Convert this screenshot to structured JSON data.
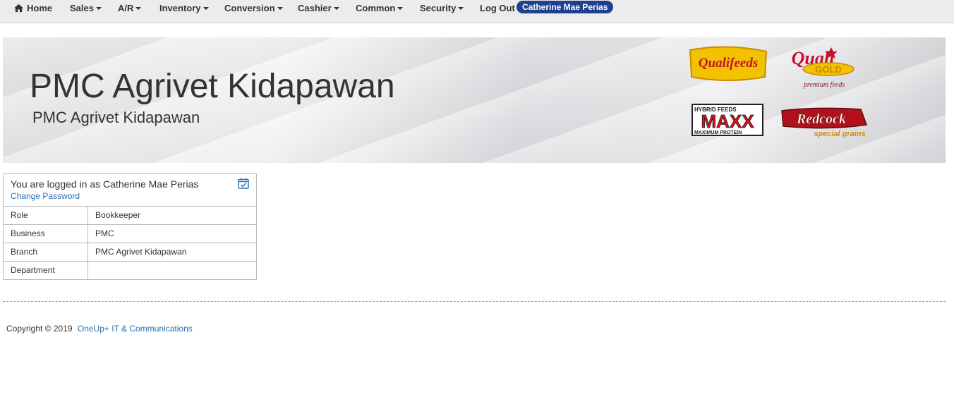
{
  "nav": {
    "home": "Home",
    "sales": "Sales",
    "ar": "A/R",
    "inventory": "Inventory",
    "conversion": "Conversion",
    "cashier": "Cashier",
    "common": "Common",
    "security": "Security",
    "logout": "Log Out",
    "user": "Catherine Mae Perias"
  },
  "banner": {
    "title": "PMC Agrivet Kidapawan",
    "subtitle": "PMC Agrivet Kidapawan",
    "logos": {
      "qualifeeds": "Qualifeeds",
      "qualigold_1": "Quali",
      "qualigold_2": "GOLD",
      "qualigold_3": "premium feeds",
      "maxx_1": "HYBRID FEEDS",
      "maxx_2": "MAXX",
      "maxx_3": "MAXIMUM PROTEIN",
      "redcock_1": "Redcock",
      "redcock_2": "special grains"
    }
  },
  "panel": {
    "logged_in": "You are logged in as Catherine Mae Perias",
    "change_password": "Change Password",
    "rows": [
      {
        "label": "Role",
        "value": "Bookkeeper"
      },
      {
        "label": "Business",
        "value": "PMC"
      },
      {
        "label": "Branch",
        "value": "PMC Agrivet Kidapawan"
      },
      {
        "label": "Department",
        "value": ""
      }
    ]
  },
  "footer": {
    "copyright": "Copyright © 2019",
    "company": "OneUp+ IT & Communications"
  },
  "colors": {
    "badge": "#1f3f8f",
    "link": "#2a6fb0",
    "navbar": "#ececec"
  }
}
